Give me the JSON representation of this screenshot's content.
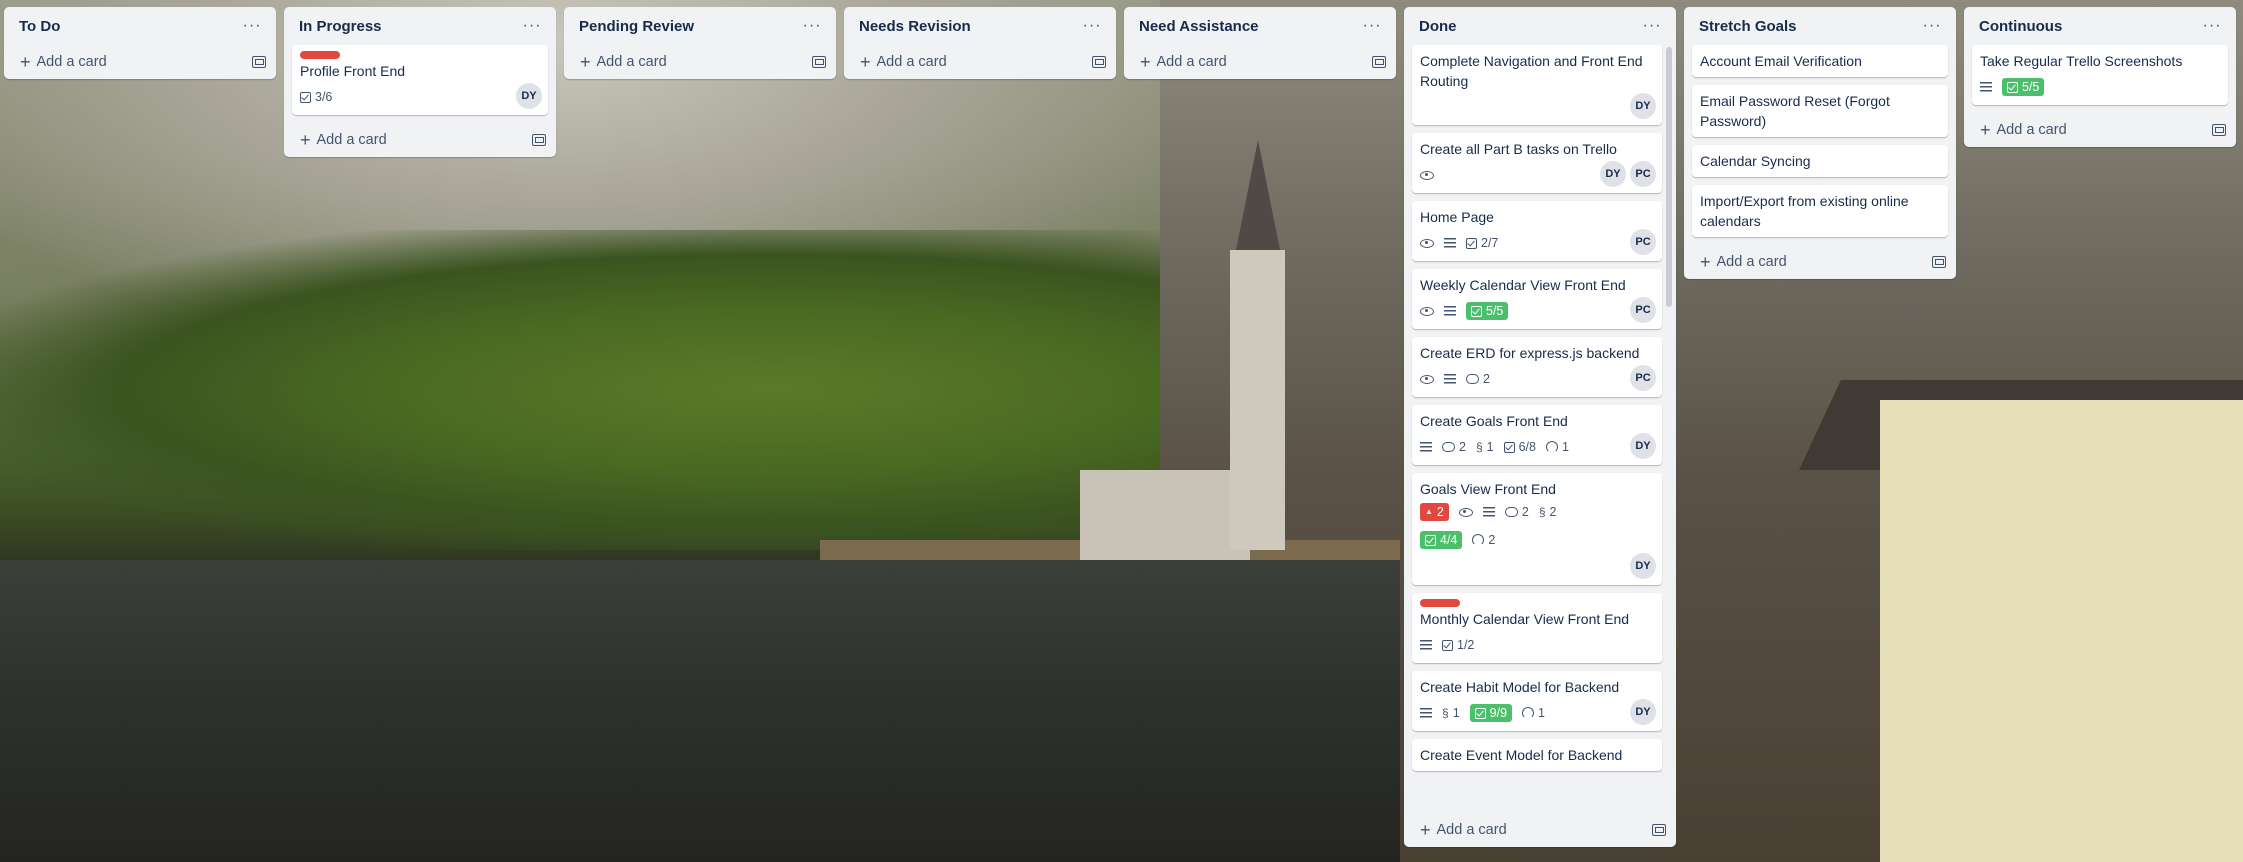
{
  "board": {
    "add_card_label": "Add a card",
    "lists": [
      {
        "title": "To Do",
        "cards": []
      },
      {
        "title": "In Progress",
        "cards": [
          {
            "title": "Profile Front End",
            "label_color": "#e2483d",
            "checklist": "3/6",
            "members": [
              "DY"
            ]
          }
        ]
      },
      {
        "title": "Pending Review",
        "cards": []
      },
      {
        "title": "Needs Revision",
        "cards": []
      },
      {
        "title": "Need Assistance",
        "cards": []
      },
      {
        "title": "Done",
        "cards": [
          {
            "title": "Complete Navigation and Front End Routing",
            "members": [
              "DY"
            ]
          },
          {
            "title": "Create all Part B tasks on Trello",
            "watch": true,
            "members": [
              "DY",
              "PC"
            ]
          },
          {
            "title": "Home Page",
            "watch": true,
            "description": true,
            "checklist": "2/7",
            "members": [
              "PC"
            ]
          },
          {
            "title": "Weekly Calendar View Front End",
            "watch": true,
            "description": true,
            "checklist_complete": "5/5",
            "members": [
              "PC"
            ]
          },
          {
            "title": "Create ERD for express.js backend",
            "watch": true,
            "description": true,
            "comments": "2",
            "members": [
              "PC"
            ]
          },
          {
            "title": "Create Goals Front End",
            "description": true,
            "comments": "2",
            "attachments": "1",
            "checklist": "6/8",
            "github": "1",
            "members": [
              "DY"
            ]
          },
          {
            "title": "Goals View Front End",
            "notifications": "2",
            "watch": true,
            "description": true,
            "comments": "2",
            "attachments": "2",
            "checklist_complete": "4/4",
            "github": "2",
            "members": [
              "DY"
            ]
          },
          {
            "title": "Monthly Calendar View Front End",
            "label_color": "#e2483d",
            "description": true,
            "checklist": "1/2"
          },
          {
            "title": "Create Habit Model for Backend",
            "description": true,
            "attachments": "1",
            "checklist_complete": "9/9",
            "github": "1",
            "members": [
              "DY"
            ]
          },
          {
            "title": "Create Event Model for Backend"
          }
        ]
      },
      {
        "title": "Stretch Goals",
        "cards": [
          {
            "title": "Account Email Verification"
          },
          {
            "title": "Email Password Reset (Forgot Password)"
          },
          {
            "title": "Calendar Syncing"
          },
          {
            "title": "Import/Export from existing online calendars"
          }
        ]
      },
      {
        "title": "Continuous",
        "cards": [
          {
            "title": "Take Regular Trello Screenshots",
            "description": true,
            "checklist_complete": "5/5"
          }
        ]
      }
    ]
  },
  "colors": {
    "list_bg": "#f1f2f4",
    "label_red": "#e2483d",
    "badge_green": "#4bbf6b",
    "text": "#172b4d"
  },
  "icons": {
    "list_menu": "···",
    "add": "+",
    "template": "template-icon",
    "description": "description-icon",
    "checklist": "checklist-icon",
    "watch": "eye-icon",
    "comments": "comment-icon",
    "attachments": "paperclip-icon",
    "github": "github-icon",
    "notifications": "bell-icon"
  }
}
